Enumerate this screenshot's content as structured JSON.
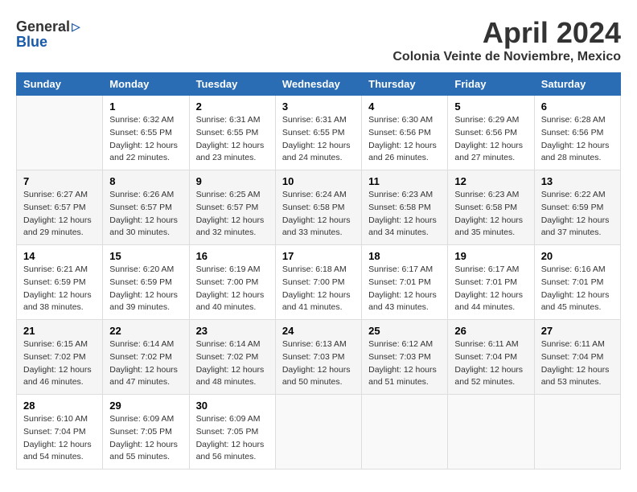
{
  "logo": {
    "general": "General",
    "blue": "Blue"
  },
  "header": {
    "title": "April 2024",
    "subtitle": "Colonia Veinte de Noviembre, Mexico"
  },
  "calendar": {
    "weekdays": [
      "Sunday",
      "Monday",
      "Tuesday",
      "Wednesday",
      "Thursday",
      "Friday",
      "Saturday"
    ],
    "weeks": [
      [
        {
          "day": "",
          "info": ""
        },
        {
          "day": "1",
          "info": "Sunrise: 6:32 AM\nSunset: 6:55 PM\nDaylight: 12 hours\nand 22 minutes."
        },
        {
          "day": "2",
          "info": "Sunrise: 6:31 AM\nSunset: 6:55 PM\nDaylight: 12 hours\nand 23 minutes."
        },
        {
          "day": "3",
          "info": "Sunrise: 6:31 AM\nSunset: 6:55 PM\nDaylight: 12 hours\nand 24 minutes."
        },
        {
          "day": "4",
          "info": "Sunrise: 6:30 AM\nSunset: 6:56 PM\nDaylight: 12 hours\nand 26 minutes."
        },
        {
          "day": "5",
          "info": "Sunrise: 6:29 AM\nSunset: 6:56 PM\nDaylight: 12 hours\nand 27 minutes."
        },
        {
          "day": "6",
          "info": "Sunrise: 6:28 AM\nSunset: 6:56 PM\nDaylight: 12 hours\nand 28 minutes."
        }
      ],
      [
        {
          "day": "7",
          "info": "Sunrise: 6:27 AM\nSunset: 6:57 PM\nDaylight: 12 hours\nand 29 minutes."
        },
        {
          "day": "8",
          "info": "Sunrise: 6:26 AM\nSunset: 6:57 PM\nDaylight: 12 hours\nand 30 minutes."
        },
        {
          "day": "9",
          "info": "Sunrise: 6:25 AM\nSunset: 6:57 PM\nDaylight: 12 hours\nand 32 minutes."
        },
        {
          "day": "10",
          "info": "Sunrise: 6:24 AM\nSunset: 6:58 PM\nDaylight: 12 hours\nand 33 minutes."
        },
        {
          "day": "11",
          "info": "Sunrise: 6:23 AM\nSunset: 6:58 PM\nDaylight: 12 hours\nand 34 minutes."
        },
        {
          "day": "12",
          "info": "Sunrise: 6:23 AM\nSunset: 6:58 PM\nDaylight: 12 hours\nand 35 minutes."
        },
        {
          "day": "13",
          "info": "Sunrise: 6:22 AM\nSunset: 6:59 PM\nDaylight: 12 hours\nand 37 minutes."
        }
      ],
      [
        {
          "day": "14",
          "info": "Sunrise: 6:21 AM\nSunset: 6:59 PM\nDaylight: 12 hours\nand 38 minutes."
        },
        {
          "day": "15",
          "info": "Sunrise: 6:20 AM\nSunset: 6:59 PM\nDaylight: 12 hours\nand 39 minutes."
        },
        {
          "day": "16",
          "info": "Sunrise: 6:19 AM\nSunset: 7:00 PM\nDaylight: 12 hours\nand 40 minutes."
        },
        {
          "day": "17",
          "info": "Sunrise: 6:18 AM\nSunset: 7:00 PM\nDaylight: 12 hours\nand 41 minutes."
        },
        {
          "day": "18",
          "info": "Sunrise: 6:17 AM\nSunset: 7:01 PM\nDaylight: 12 hours\nand 43 minutes."
        },
        {
          "day": "19",
          "info": "Sunrise: 6:17 AM\nSunset: 7:01 PM\nDaylight: 12 hours\nand 44 minutes."
        },
        {
          "day": "20",
          "info": "Sunrise: 6:16 AM\nSunset: 7:01 PM\nDaylight: 12 hours\nand 45 minutes."
        }
      ],
      [
        {
          "day": "21",
          "info": "Sunrise: 6:15 AM\nSunset: 7:02 PM\nDaylight: 12 hours\nand 46 minutes."
        },
        {
          "day": "22",
          "info": "Sunrise: 6:14 AM\nSunset: 7:02 PM\nDaylight: 12 hours\nand 47 minutes."
        },
        {
          "day": "23",
          "info": "Sunrise: 6:14 AM\nSunset: 7:02 PM\nDaylight: 12 hours\nand 48 minutes."
        },
        {
          "day": "24",
          "info": "Sunrise: 6:13 AM\nSunset: 7:03 PM\nDaylight: 12 hours\nand 50 minutes."
        },
        {
          "day": "25",
          "info": "Sunrise: 6:12 AM\nSunset: 7:03 PM\nDaylight: 12 hours\nand 51 minutes."
        },
        {
          "day": "26",
          "info": "Sunrise: 6:11 AM\nSunset: 7:04 PM\nDaylight: 12 hours\nand 52 minutes."
        },
        {
          "day": "27",
          "info": "Sunrise: 6:11 AM\nSunset: 7:04 PM\nDaylight: 12 hours\nand 53 minutes."
        }
      ],
      [
        {
          "day": "28",
          "info": "Sunrise: 6:10 AM\nSunset: 7:04 PM\nDaylight: 12 hours\nand 54 minutes."
        },
        {
          "day": "29",
          "info": "Sunrise: 6:09 AM\nSunset: 7:05 PM\nDaylight: 12 hours\nand 55 minutes."
        },
        {
          "day": "30",
          "info": "Sunrise: 6:09 AM\nSunset: 7:05 PM\nDaylight: 12 hours\nand 56 minutes."
        },
        {
          "day": "",
          "info": ""
        },
        {
          "day": "",
          "info": ""
        },
        {
          "day": "",
          "info": ""
        },
        {
          "day": "",
          "info": ""
        }
      ]
    ]
  }
}
